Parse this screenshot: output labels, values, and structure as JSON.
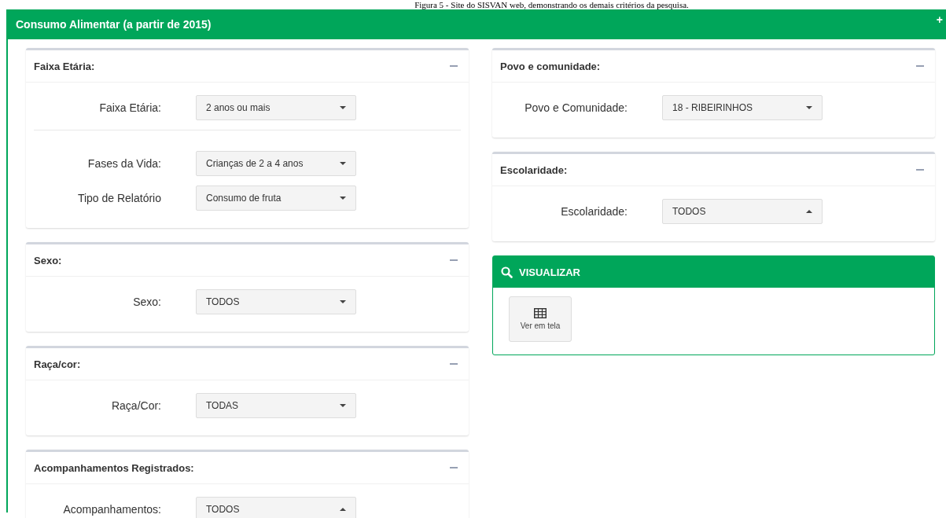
{
  "caption": "Figura 5 - Site do SISVAN web, demonstrando os demais critérios da pesquisa.",
  "header": {
    "title": "Consumo Alimentar (a partir de 2015)",
    "expand": "+"
  },
  "left_sections": [
    {
      "title": "Faixa Etária:",
      "groups": [
        [
          {
            "label": "Faixa Etária:",
            "value": "2 anos ou mais",
            "expanded": false
          }
        ],
        [
          {
            "label": "Fases da Vida:",
            "value": "Crianças de 2 a 4 anos",
            "expanded": false
          },
          {
            "label": "Tipo de Relatório",
            "value": "Consumo de fruta",
            "expanded": false
          }
        ]
      ]
    },
    {
      "title": "Sexo:",
      "groups": [
        [
          {
            "label": "Sexo:",
            "value": "TODOS",
            "expanded": false
          }
        ]
      ]
    },
    {
      "title": "Raça/cor:",
      "groups": [
        [
          {
            "label": "Raça/Cor:",
            "value": "TODAS",
            "expanded": false
          }
        ]
      ]
    },
    {
      "title": "Acompanhamentos Registrados:",
      "groups": [
        [
          {
            "label": "Acompanhamentos:",
            "value": "TODOS",
            "expanded": true
          }
        ]
      ]
    }
  ],
  "right_sections": [
    {
      "title": "Povo e comunidade:",
      "groups": [
        [
          {
            "label": "Povo e Comunidade:",
            "value": "18 - RIBEIRINHOS",
            "expanded": false
          }
        ]
      ]
    },
    {
      "title": "Escolaridade:",
      "groups": [
        [
          {
            "label": "Escolaridade:",
            "value": "TODOS",
            "expanded": true
          }
        ]
      ]
    }
  ],
  "visualize": {
    "title": "VISUALIZAR",
    "button": "Ver em tela"
  }
}
